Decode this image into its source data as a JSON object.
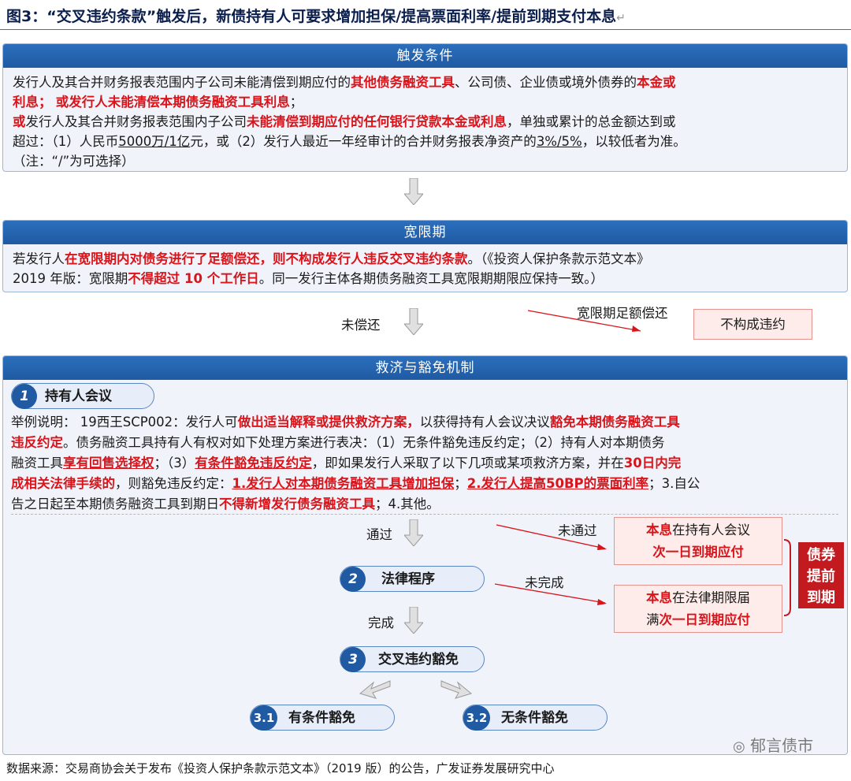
{
  "figure": {
    "title": "图3：“交叉违约条款”触发后，新债持有人可要求增加担保/提高票面利率/提前到期支付本息",
    "source": "数据来源：交易商协会关于发布《投资人保护条款示范文本》（2019 版）的公告，广发证券发展研究中心",
    "watermark": "郁言债市"
  },
  "trigger": {
    "header": "触发条件",
    "l1_a": "发行人及其合并财务报表范围内子公司未能清偿到期应付的",
    "l1_b": "其他债务融资工具",
    "l1_c": "、公司债、企业债或境外债券的",
    "l1_d": "本金或",
    "l2_a": "利息",
    "l2_b": "；",
    "l2_c": "或发行人",
    "l2_d": "未能清偿本期债务融资工具利息",
    "l2_e": "；",
    "l3_a": "或",
    "l3_b": "发行人及其合并财务报表范围内子公司",
    "l3_c": "未能清偿到期应付的任何银行贷款本金或利息",
    "l3_d": "，单独或累计的总金额达到或",
    "l4_a": "超过：（1）人民币",
    "l4_b": "5000万/1亿",
    "l4_c": "元，或（2）发行人最近一年经审计的合并财务报表净资产的",
    "l4_d": "3%/5%",
    "l4_e": "，以较低者为准。",
    "l5": "（注：“/”为可选择）"
  },
  "grace": {
    "header": "宽限期",
    "l1_a": "若发行人",
    "l1_b": "在宽限期内对债务进行了足额偿还，则不构成发行人违反交叉违约条款",
    "l1_c": "。（《投资人保护条款示范文本》",
    "l2_a": "2019 年版：宽限期",
    "l2_b": "不得超过 10 个工作日",
    "l2_c": "。同一发行主体各期债务融资工具宽限期期限应保持一致。）"
  },
  "grace_flow": {
    "unpaid_label": "未偿还",
    "paid_label": "宽限期足额偿还",
    "no_default_box": "不构成违约"
  },
  "remedy": {
    "header": "救济与豁免机制",
    "step1": {
      "num": "1",
      "label": "持有人会议"
    },
    "p1_a": "举例说明：  19西王SCP002：发行人可",
    "p1_b": "做出适当解释或提供救济方案，",
    "p1_c": "以获得持有人会议决议",
    "p1_d": "豁免本期债务融资工具",
    "p2_a": "违反约定",
    "p2_b": "。债务融资工具持有人有权对如下处理方案进行表决：（1）无条件豁免违反约定；（2）持有人对本期债务",
    "p3_a": "融资工具",
    "p3_b": "享有回售选择权",
    "p3_c": "；（3）",
    "p3_d": "有条件豁免违反约定",
    "p3_e": "，即如果发行人采取了以下几项或某项救济方案，并在",
    "p3_f": "30日内完",
    "p4_a": "成相关法律手续的",
    "p4_b": "，则豁免违反约定：",
    "p4_c": "1.发行人对本期债务融资工具增加担保",
    "p4_d": "；",
    "p4_e": "2.发行人提高50BP的票面利率",
    "p4_f": "；3.自公",
    "p5_a": "告之日起至本期债务融资工具到期日",
    "p5_b": "不得新增发行债务融资工具",
    "p5_c": "；4.其他。"
  },
  "flow": {
    "pass_label": "通过",
    "fail_label": "未通过",
    "box_meeting_a": "本息",
    "box_meeting_b": "在持有人会议",
    "box_meeting_c": "次一日到期应付",
    "step2": {
      "num": "2",
      "label": "法律程序"
    },
    "incomplete_label": "未完成",
    "box_legal_a": "本息",
    "box_legal_b": "在法律期限届",
    "box_legal_c": "满",
    "box_legal_d": "次一日到期应付",
    "complete_label": "完成",
    "step3": {
      "num": "3",
      "label": "交叉违约豁免"
    },
    "step31": {
      "num": "3.1",
      "label": "有条件豁免"
    },
    "step32": {
      "num": "3.2",
      "label": "无条件豁免"
    },
    "accel_box": [
      "债券",
      "提前",
      "到期"
    ]
  },
  "colors": {
    "header_blue": "#1f5aa2",
    "panel_bg": "#f0f4fa",
    "emphasis_red": "#d9141b",
    "accel_red": "#c21a1f",
    "pink_box": "#fdecea"
  }
}
